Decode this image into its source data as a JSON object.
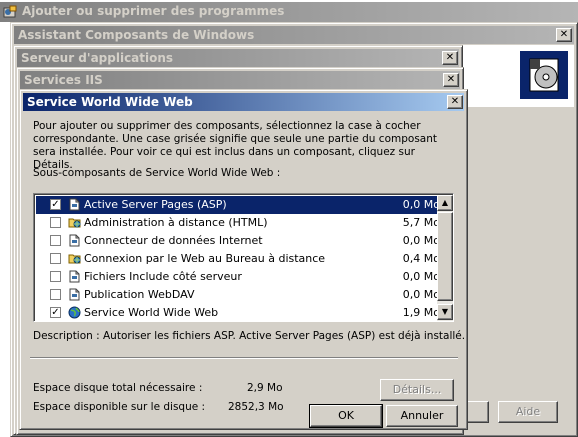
{
  "windows": {
    "programs_title": "Ajouter ou supprimer des programmes",
    "components_wizard_title": "Assistant Composants de Windows",
    "app_server_title": "Serveur d'applications",
    "iis_title": "Services IIS",
    "www_title": "Service World Wide Web"
  },
  "dialog": {
    "intro": "Pour ajouter ou supprimer des composants, sélectionnez la case à cocher correspondante. Une case grisée signifie que seule une partie du composant sera installée. Pour voir ce qui est inclus dans un composant, cliquez sur Détails.",
    "list_label": "Sous-composants de Service World Wide Web :",
    "components": [
      {
        "name": "Active Server Pages (ASP)",
        "size": "0,0 Mo",
        "checked": true,
        "selected": true,
        "icon": "document-icon"
      },
      {
        "name": "Administration à distance (HTML)",
        "size": "5,7 Mo",
        "checked": false,
        "selected": false,
        "icon": "folder-globe-icon"
      },
      {
        "name": "Connecteur de données Internet",
        "size": "0,0 Mo",
        "checked": false,
        "selected": false,
        "icon": "document-icon"
      },
      {
        "name": "Connexion par le Web au Bureau à distance",
        "size": "0,4 Mo",
        "checked": false,
        "selected": false,
        "icon": "folder-globe-icon"
      },
      {
        "name": "Fichiers Include côté serveur",
        "size": "0,0 Mo",
        "checked": false,
        "selected": false,
        "icon": "document-icon"
      },
      {
        "name": "Publication WebDAV",
        "size": "0,0 Mo",
        "checked": false,
        "selected": false,
        "icon": "document-icon"
      },
      {
        "name": "Service World Wide Web",
        "size": "1,9 Mo",
        "checked": true,
        "selected": false,
        "icon": "globe-icon"
      }
    ],
    "description_label": "Description :",
    "description_text": "Autoriser les fichiers ASP. Active Server Pages (ASP) est déjà installé.",
    "disk_required_label": "Espace disque total nécessaire :",
    "disk_required_value": "2,9 Mo",
    "disk_available_label": "Espace disponible sur le disque :",
    "disk_available_value": "2852,3 Mo",
    "details_button": "Détails...",
    "ok_button": "OK",
    "cancel_button": "Annuler"
  },
  "background": {
    "help_button": "Aide"
  },
  "colors": {
    "active_title": "#0a246a",
    "inactive_title": "#808080",
    "window_face": "#d4d0c8",
    "selection": "#0a246a"
  }
}
